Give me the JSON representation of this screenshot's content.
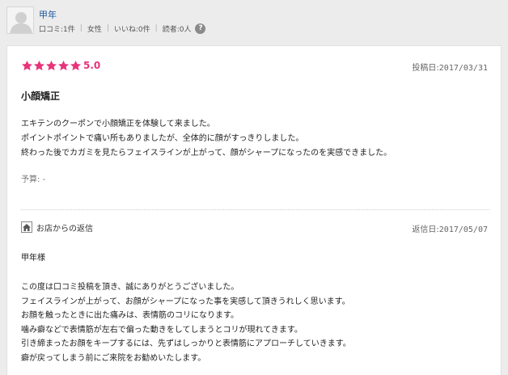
{
  "user": {
    "name": "甲年",
    "stats": [
      "口コミ:1件",
      "女性",
      "いいね:0件",
      "読者:0人"
    ],
    "help_icon": "help-circle-icon",
    "help_glyph": "?"
  },
  "review": {
    "rating": 5.0,
    "rating_text": "5.0",
    "star_count": 5,
    "star_color": "#e8337a",
    "date_label": "投稿日:",
    "date": "2017/03/31",
    "title": "小顔矯正",
    "body_lines": [
      "エキテンのクーポンで小顔矯正を体験して来ました。",
      "ポイントポイントで痛い所もありましたが、全体的に顔がすっきりしました。",
      "終わった後でカガミを見たらフェイスラインが上がって、顔がシャープになったのを実感できました。"
    ],
    "budget": "予算: -"
  },
  "reply": {
    "label": "お店からの返信",
    "date_label": "返信日:",
    "date": "2017/05/07",
    "salutation": "甲年様",
    "body_lines": [
      "この度は口コミ投稿を頂き、誠にありがとうございました。",
      "フェイスラインが上がって、お顔がシャープになった事を実感して頂きうれしく思います。",
      "お顔を触ったときに出た痛みは、表情筋のコリになります。",
      "噛み癖などで表情筋が左右で偏った動きをしてしまうとコリが現れてきます。",
      "引き締まったお顔をキープするには、先ずはしっかりと表情筋にアプローチしていきます。",
      "癖が戻ってしまう前にご来院をお勧めいたします。"
    ]
  }
}
